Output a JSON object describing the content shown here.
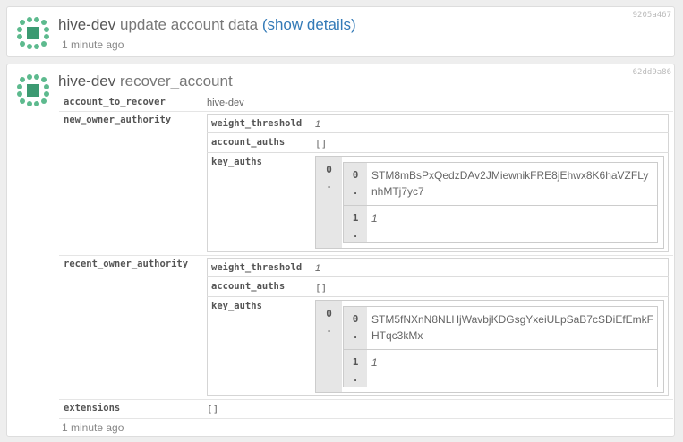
{
  "ops": [
    {
      "account": "hive-dev",
      "action": "update account data",
      "details_link": "(show details)",
      "hash": "9205a467",
      "time": "1 minute ago"
    },
    {
      "account": "hive-dev",
      "action": "recover_account",
      "hash": "62dd9a86",
      "time": "1 minute ago",
      "fields": {
        "account_to_recover": {
          "key": "account_to_recover",
          "value": "hive-dev"
        },
        "new_owner_authority": {
          "key": "new_owner_authority",
          "weight_threshold": {
            "key": "weight_threshold",
            "value": "1"
          },
          "account_auths": {
            "key": "account_auths",
            "value": "[]"
          },
          "key_auths": {
            "key": "key_auths",
            "index": "0",
            "index_sep": ".",
            "entries": [
              {
                "idx": "0",
                "sep": ".",
                "value": "STM8mBsPxQedzDAv2JMiewnikFRE8jEhwx8K6haVZFLynhMTj7yc7"
              },
              {
                "idx": "1",
                "sep": ".",
                "value": "1"
              }
            ]
          }
        },
        "recent_owner_authority": {
          "key": "recent_owner_authority",
          "weight_threshold": {
            "key": "weight_threshold",
            "value": "1"
          },
          "account_auths": {
            "key": "account_auths",
            "value": "[]"
          },
          "key_auths": {
            "key": "key_auths",
            "index": "0",
            "index_sep": ".",
            "entries": [
              {
                "idx": "0",
                "sep": ".",
                "value": "STM5fNXnN8NLHjWavbjKDGsgYxeiULpSaB7cSDiEfEmkFHTqc3kMx"
              },
              {
                "idx": "1",
                "sep": ".",
                "value": "1"
              }
            ]
          }
        },
        "extensions": {
          "key": "extensions",
          "value": "[]"
        }
      }
    }
  ],
  "colors": {
    "avatar_green": "#5dba8e",
    "avatar_square": "#3c9a72",
    "link": "#337ab7",
    "background": "#eeeeee"
  },
  "icons": {
    "avatar": "hive-dev-identicon"
  }
}
